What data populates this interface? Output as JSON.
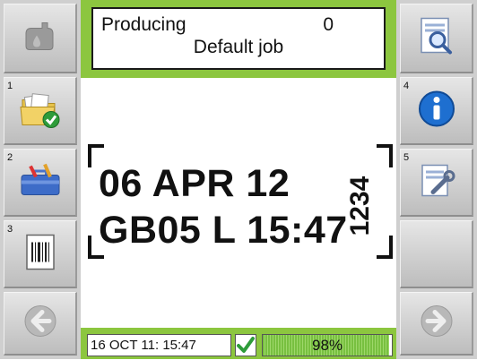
{
  "status": {
    "state": "Producing",
    "count": "0",
    "job_name": "Default job"
  },
  "left_buttons": [
    {
      "icon": "ink-drop-icon",
      "number": ""
    },
    {
      "icon": "folder-check-icon",
      "number": "1"
    },
    {
      "icon": "toolbox-icon",
      "number": "2"
    },
    {
      "icon": "barcode-document-icon",
      "number": "3"
    },
    {
      "icon": "arrow-left-icon",
      "number": ""
    }
  ],
  "right_buttons": [
    {
      "icon": "preview-magnifier-icon",
      "number": ""
    },
    {
      "icon": "info-icon",
      "number": "4"
    },
    {
      "icon": "service-wrench-icon",
      "number": "5"
    },
    {
      "icon": "",
      "number": ""
    },
    {
      "icon": "arrow-right-icon",
      "number": ""
    }
  ],
  "print_preview": {
    "line1": "06 APR 12",
    "line2": "GB05 L 15:47",
    "vertical_code": "1234"
  },
  "footer": {
    "datetime": "16 OCT 11: 15:47",
    "progress_percent": 98,
    "progress_label": "98%"
  },
  "colors": {
    "accent_green": "#8cc63f",
    "info_blue": "#1e6fd0",
    "panel_gray": "#cfcfcf"
  }
}
